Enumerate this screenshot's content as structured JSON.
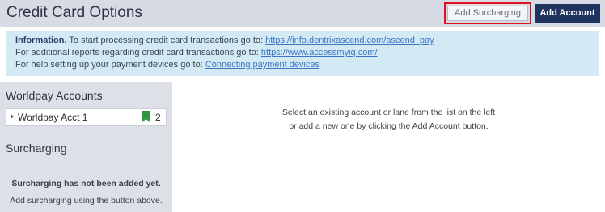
{
  "header": {
    "title": "Credit Card Options",
    "add_surcharging_label": "Add Surcharging",
    "add_account_label": "Add Account"
  },
  "info": {
    "line1_label": "Information.",
    "line1_text": " To start processing credit card transactions go to: ",
    "line1_link": "https://info.dentrixascend.com/ascend_pay",
    "line2_text": "For additional reports regarding credit card transactions go to: ",
    "line2_link": "https://www.accessmyiq.com/",
    "line3_text": "For help setting up your payment devices go to: ",
    "line3_link": "Connecting payment devices"
  },
  "sidebar": {
    "accounts_heading": "Worldpay Accounts",
    "accounts": [
      {
        "name": "Worldpay Acct 1",
        "count": "2"
      }
    ],
    "surcharging_heading": "Surcharging",
    "surcharging_empty_title": "Surcharging has not been added yet.",
    "surcharging_empty_text": "Add surcharging using the button above."
  },
  "main": {
    "line1": "Select an existing account or lane from the list on the left",
    "line2": "or add a new one by clicking the Add Account button."
  },
  "colors": {
    "header_bg": "#d6dbe6",
    "primary_button": "#1f3560",
    "highlight_border": "#e0131d",
    "info_bg": "#d3eaf4",
    "sidebar_bg": "#dde0e6",
    "bookmark": "#2e9a3e",
    "link": "#3a76c5"
  },
  "icons": {
    "expand": "caret-right-icon",
    "bookmark": "bookmark-icon"
  }
}
